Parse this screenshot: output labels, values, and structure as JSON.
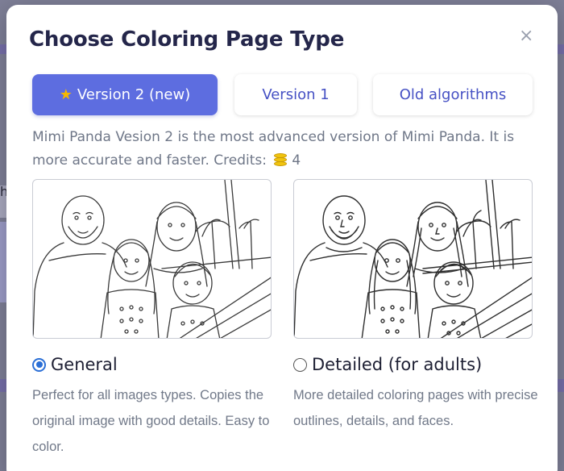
{
  "modal": {
    "title": "Choose Coloring Page Type",
    "close_glyph": "×"
  },
  "tabs": [
    {
      "label": "Version 2 (new)",
      "active": true,
      "icon": "star-icon",
      "icon_glyph": "★"
    },
    {
      "label": "Version 1",
      "active": false
    },
    {
      "label": "Old algorithms",
      "active": false
    }
  ],
  "description": {
    "text": "Mimi Panda Vesion 2 is the most advanced version of Mimi Panda. It is more accurate and faster. Credits:",
    "credits_icon": "coins-icon",
    "credits": "4"
  },
  "options": [
    {
      "label": "General",
      "checked": true,
      "description": "Perfect for all images types. Copies the original image with good details. Easy to color."
    },
    {
      "label": "Detailed (for adults)",
      "checked": false,
      "description": "More detailed coloring pages with precise outlines, details, and faces."
    }
  ],
  "backdrop": {
    "char": "h"
  },
  "colors": {
    "accent": "#5d6de0",
    "tab_text": "#4651c4",
    "title": "#24264a",
    "muted_text": "#6f7788",
    "radio": "#2b6fd6"
  }
}
